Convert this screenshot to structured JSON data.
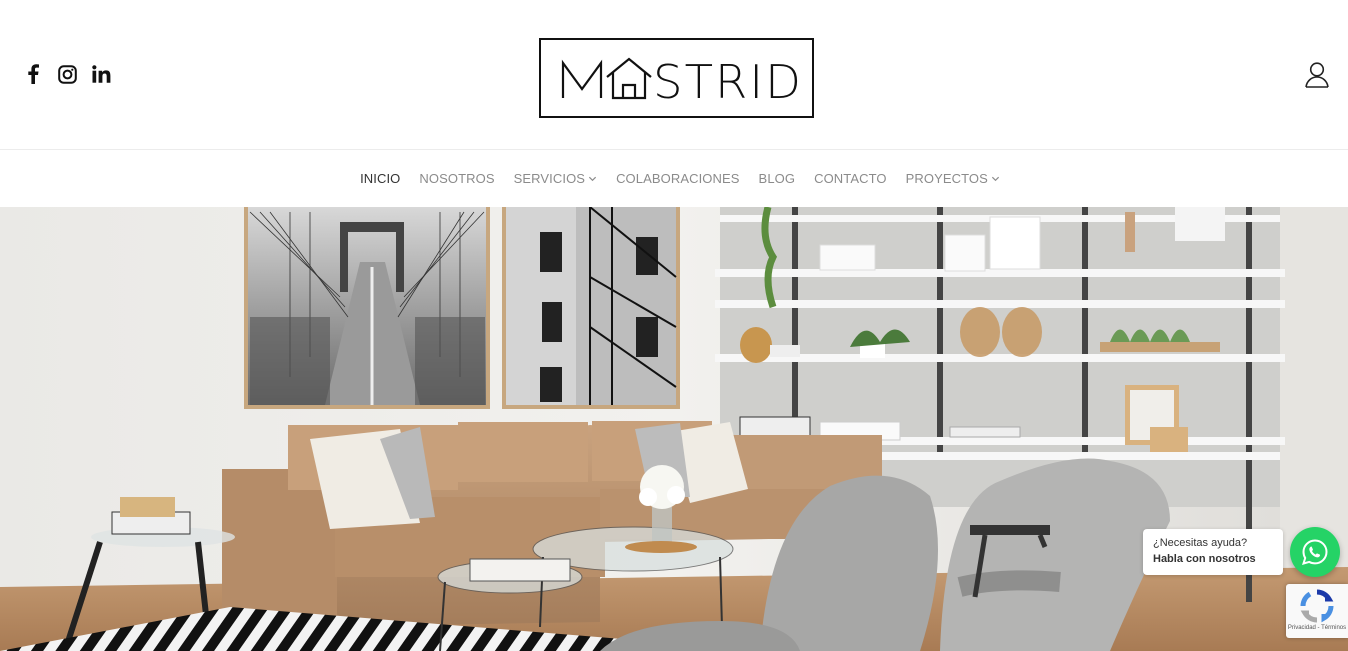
{
  "header": {
    "logo_text": "MASTRID",
    "social": [
      {
        "name": "facebook",
        "icon": "facebook-icon"
      },
      {
        "name": "instagram",
        "icon": "instagram-icon"
      },
      {
        "name": "linkedin",
        "icon": "linkedin-icon"
      }
    ],
    "user_icon": "user-icon"
  },
  "nav": {
    "items": [
      {
        "label": "INICIO",
        "active": true,
        "dropdown": false
      },
      {
        "label": "NOSOTROS",
        "active": false,
        "dropdown": false
      },
      {
        "label": "SERVICIOS",
        "active": false,
        "dropdown": true
      },
      {
        "label": "COLABORACIONES",
        "active": false,
        "dropdown": false
      },
      {
        "label": "BLOG",
        "active": false,
        "dropdown": false
      },
      {
        "label": "CONTACTO",
        "active": false,
        "dropdown": false
      },
      {
        "label": "PROYECTOS",
        "active": false,
        "dropdown": true
      }
    ]
  },
  "whatsapp": {
    "line1": "¿Necesitas ayuda?",
    "line2": "Habla con nosotros",
    "color": "#25d366"
  },
  "recaptcha": {
    "text": "Privacidad - Términos"
  },
  "colors": {
    "nav_active": "#333333",
    "nav_inactive": "#8b8b8b"
  }
}
